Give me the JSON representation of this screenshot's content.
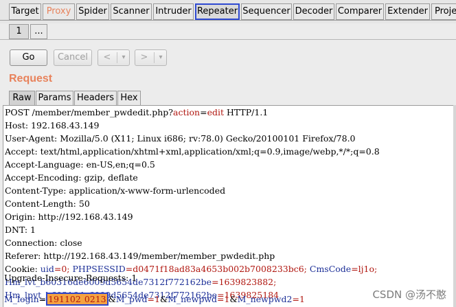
{
  "tabs": {
    "target": "Target",
    "proxy": "Proxy",
    "spider": "Spider",
    "scanner": "Scanner",
    "intruder": "Intruder",
    "repeater": "Repeater",
    "sequencer": "Sequencer",
    "decoder": "Decoder",
    "comparer": "Comparer",
    "extender": "Extender",
    "project": "Proje"
  },
  "subtabs": {
    "first": "1",
    "more": "..."
  },
  "toolbar": {
    "go": "Go",
    "cancel": "Cancel",
    "back": "<",
    "back_menu": "▾",
    "forward": ">",
    "forward_menu": "▾"
  },
  "request": {
    "title": "Request",
    "tabs": {
      "raw": "Raw",
      "params": "Params",
      "headers": "Headers",
      "hex": "Hex"
    },
    "line1a": "POST /member/member_pwdedit.php?",
    "line1_param": "action",
    "line1_eq": "=",
    "line1_val": "edit",
    "line1b": " HTTP/1.1",
    "host": "Host: 192.168.43.149",
    "user_agent": "User-Agent: Mozilla/5.0 (X11; Linux i686; rv:78.0) Gecko/20100101 Firefox/78.0",
    "accept": "Accept: text/html,application/xhtml+xml,application/xml;q=0.9,image/webp,*/*;q=0.8",
    "accept_language": "Accept-Language: en-US,en;q=0.5",
    "accept_encoding": "Accept-Encoding: gzip, deflate",
    "content_type": "Content-Type: application/x-www-form-urlencoded",
    "content_length": "Content-Length: 50",
    "origin": "Origin: http://192.168.43.149",
    "dnt": "DNT: 1",
    "connection": "Connection: close",
    "referer": "Referer: http://192.168.43.149/member/member_pwdedit.php",
    "cookie_label": "Cookie: ",
    "cookie_uid_k": "uid",
    "cookie_uid_v": "=0; ",
    "cookie_sess_k": "PHPSESSID",
    "cookie_sess_v": "=d0471f18ad83a4653b002b7008233bc6; ",
    "cookie_cms_k": "CmsCode",
    "cookie_cms_v": "=lj1o;",
    "hm_lvt_k": "Hm_lvt_b60316de6009d5654de7312f772162be",
    "hm_lvt_v": "=1639823882;",
    "hm_lpvt_k": "Hm_lpvt_b60316de6009d5654de7312f772162be",
    "hm_lpvt_v": "=1639825184",
    "upgrade": "Upgrade-Insecure-Requests: 1",
    "body_login_k": "M_login",
    "body_login_eq": "=",
    "body_login_v1": "191102",
    "body_login_v2": "0213",
    "body_pwd_sep": "&",
    "body_pwd_k": "M_pwd",
    "body_pwd_v": "=1",
    "body_newpwd_sep": "&",
    "body_newpwd_k": "M_newpwd",
    "body_newpwd_v": "=1",
    "body_newpwd2_sep": "&",
    "body_newpwd2_k": "M_newpwd2",
    "body_newpwd2_v": "=1"
  },
  "watermark": "CSDN @汤不憨",
  "colors": {
    "accent_orange": "#e8825b",
    "selection_blue": "#2e49d1",
    "param_red": "#b0160f",
    "cookie_blue": "#1c2f97",
    "highlight": "#f5a341"
  }
}
